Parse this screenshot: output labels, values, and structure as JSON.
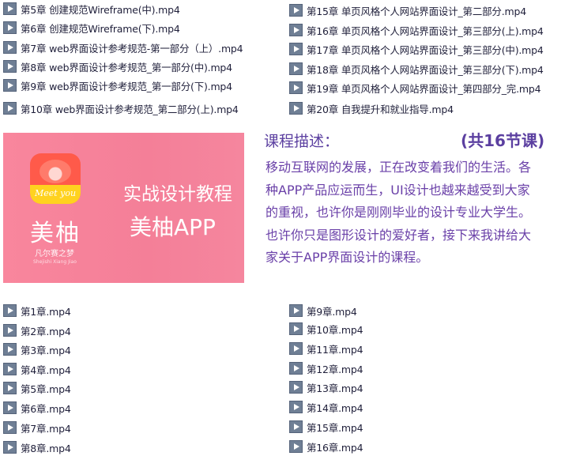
{
  "top_left_files": [
    "第5章 创建规范Wireframe(中).mp4",
    "第6章 创建规范Wireframe(下).mp4",
    "第7章 web界面设计参考规范-第一部分（上）.mp4",
    "第8章 web界面设计参考规范_第一部分(中).mp4",
    "第9章 web界面设计参考规范_第一部分(下).mp4",
    "第10章 web界面设计参考规范_第二部分(上).mp4"
  ],
  "top_right_files": [
    "第15章 单页风格个人网站界面设计_第二部分.mp4",
    "第16章 单页风格个人网站界面设计_第三部分(上).mp4",
    "第17章 单页风格个人网站界面设计_第三部分(中).mp4",
    "第18章 单页风格个人网站界面设计_第三部分(下).mp4",
    "第19章 单页风格个人网站界面设计_第四部分_完.mp4",
    "第20章 自我提升和就业指导.mp4"
  ],
  "banner": {
    "logo_text": "Meet you",
    "brand_name": "美柚",
    "brand_tagline": "凡尔赛之梦",
    "brand_subtext": "Shejishi Xiang Jiao",
    "title": "实战设计教程",
    "app": "美柚APP",
    "background_color": "#f47f98"
  },
  "description": {
    "heading": "课程描述：",
    "count": "(共16节课)",
    "lines": [
      "移动互联网的发展，正在改变着我们的生活。各",
      "种APP产品应运而生，UI设计也越来越受到大家",
      "的重视，也许你是刚刚毕业的设计专业大学生。",
      "也许你只是图形设计的爱好者，接下来我讲给大",
      "家关于APP界面设计的课程。"
    ],
    "text_color": "#6a40a8"
  },
  "bottom_left_files": [
    "第1章.mp4",
    "第2章.mp4",
    "第3章.mp4",
    "第4章.mp4",
    "第5章.mp4",
    "第6章.mp4",
    "第7章.mp4",
    "第8章.mp4"
  ],
  "bottom_right_files": [
    "第9章.mp4",
    "第10章.mp4",
    "第11章.mp4",
    "第12章.mp4",
    "第13章.mp4",
    "第14章.mp4",
    "第15章.mp4",
    "第16章.mp4"
  ],
  "icons": {
    "file": "video-file-icon"
  }
}
